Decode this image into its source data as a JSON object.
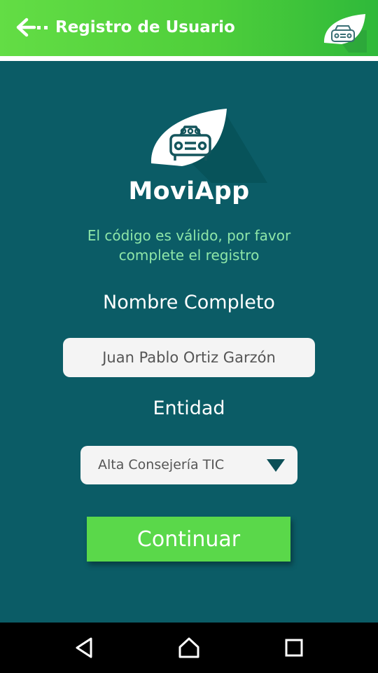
{
  "colors": {
    "appbar_green": "#4fcf3b",
    "background_teal": "#0b5c66",
    "message_green": "#8ee6a8",
    "button_green": "#5ad84a",
    "field_bg": "#f4f4f4"
  },
  "appbar": {
    "back_icon": "arrow-left-icon",
    "title": "Registro de Usuario",
    "logo_icon": "leaf-car-logo-icon"
  },
  "main": {
    "logo_icon": "leaf-car-logo-icon",
    "app_name": "MoviApp",
    "message_line1": "El código es válido, por favor",
    "message_line2": "complete el registro",
    "name_label": "Nombre Completo",
    "name_value": "Juan Pablo Ortiz Garzón",
    "entity_label": "Entidad",
    "entity_value": "Alta Consejería TIC",
    "entity_dropdown_icon": "triangle-down-icon",
    "continue_label": "Continuar"
  },
  "navbar": {
    "back_icon": "nav-back-icon",
    "home_icon": "nav-home-icon",
    "recents_icon": "nav-recents-icon"
  }
}
